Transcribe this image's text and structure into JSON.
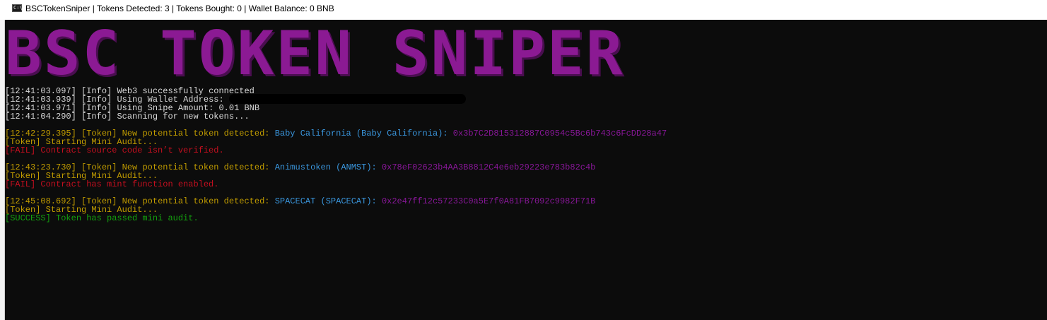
{
  "window": {
    "title": "BSCTokenSniper | Tokens Detected: 3 | Tokens Bought: 0 | Wallet Balance: 0 BNB",
    "icon": "console-icon",
    "icon_glyph": "C:\\"
  },
  "banner": {
    "text": "BSC TOKEN SNIPER",
    "color": "#8b1a93"
  },
  "log": {
    "info": [
      {
        "time": "[12:41:03.097]",
        "tag": "[Info]",
        "message": "Web3 successfully connected"
      },
      {
        "time": "[12:41:03.939]",
        "tag": "[Info]",
        "message": "Using Wallet Address:"
      },
      {
        "time": "[12:41:03.971]",
        "tag": "[Info]",
        "message": "Using Snipe Amount: 0.01 BNB"
      },
      {
        "time": "[12:41:04.290]",
        "tag": "[Info]",
        "message": "Scanning for new tokens..."
      }
    ],
    "tokens": [
      {
        "time": "[12:42:29.395]",
        "tag": "[Token]",
        "detected_text": "New potential token detected:",
        "name": "Baby California (Baby California):",
        "address": "0x3b7C2D815312887C0954c5Bc6b743c6FcDD28a47",
        "audit_start": "[Token] Starting Mini Audit...",
        "result": "[FAIL] Contract source code isn’t verified.",
        "result_status": "fail"
      },
      {
        "time": "[12:43:23.730]",
        "tag": "[Token]",
        "detected_text": "New potential token detected:",
        "name": "Animustoken (ANMST):",
        "address": "0x78eF02623b4AA3B8812C4e6eb29223e783b82c4b",
        "audit_start": "[Token] Starting Mini Audit...",
        "result": "[FAIL] Contract has mint function enabled.",
        "result_status": "fail"
      },
      {
        "time": "[12:45:08.692]",
        "tag": "[Token]",
        "detected_text": "New potential token detected:",
        "name": "SPACECAT (SPACECAT):",
        "address": "0x2e47ff12c57233C0a5E7f0A81FB7092c9982F71B",
        "audit_start": "[Token] Starting Mini Audit...",
        "result": "[SUCCESS] Token has passed mini audit.",
        "result_status": "success"
      }
    ]
  },
  "colors": {
    "console_bg": "#0c0c0c",
    "info_text": "#d9d9d9",
    "token_text": "#c19c00",
    "fail_text": "#c50f1f",
    "success_text": "#13a10e",
    "token_name": "#3a96dd",
    "token_address": "#881798"
  }
}
